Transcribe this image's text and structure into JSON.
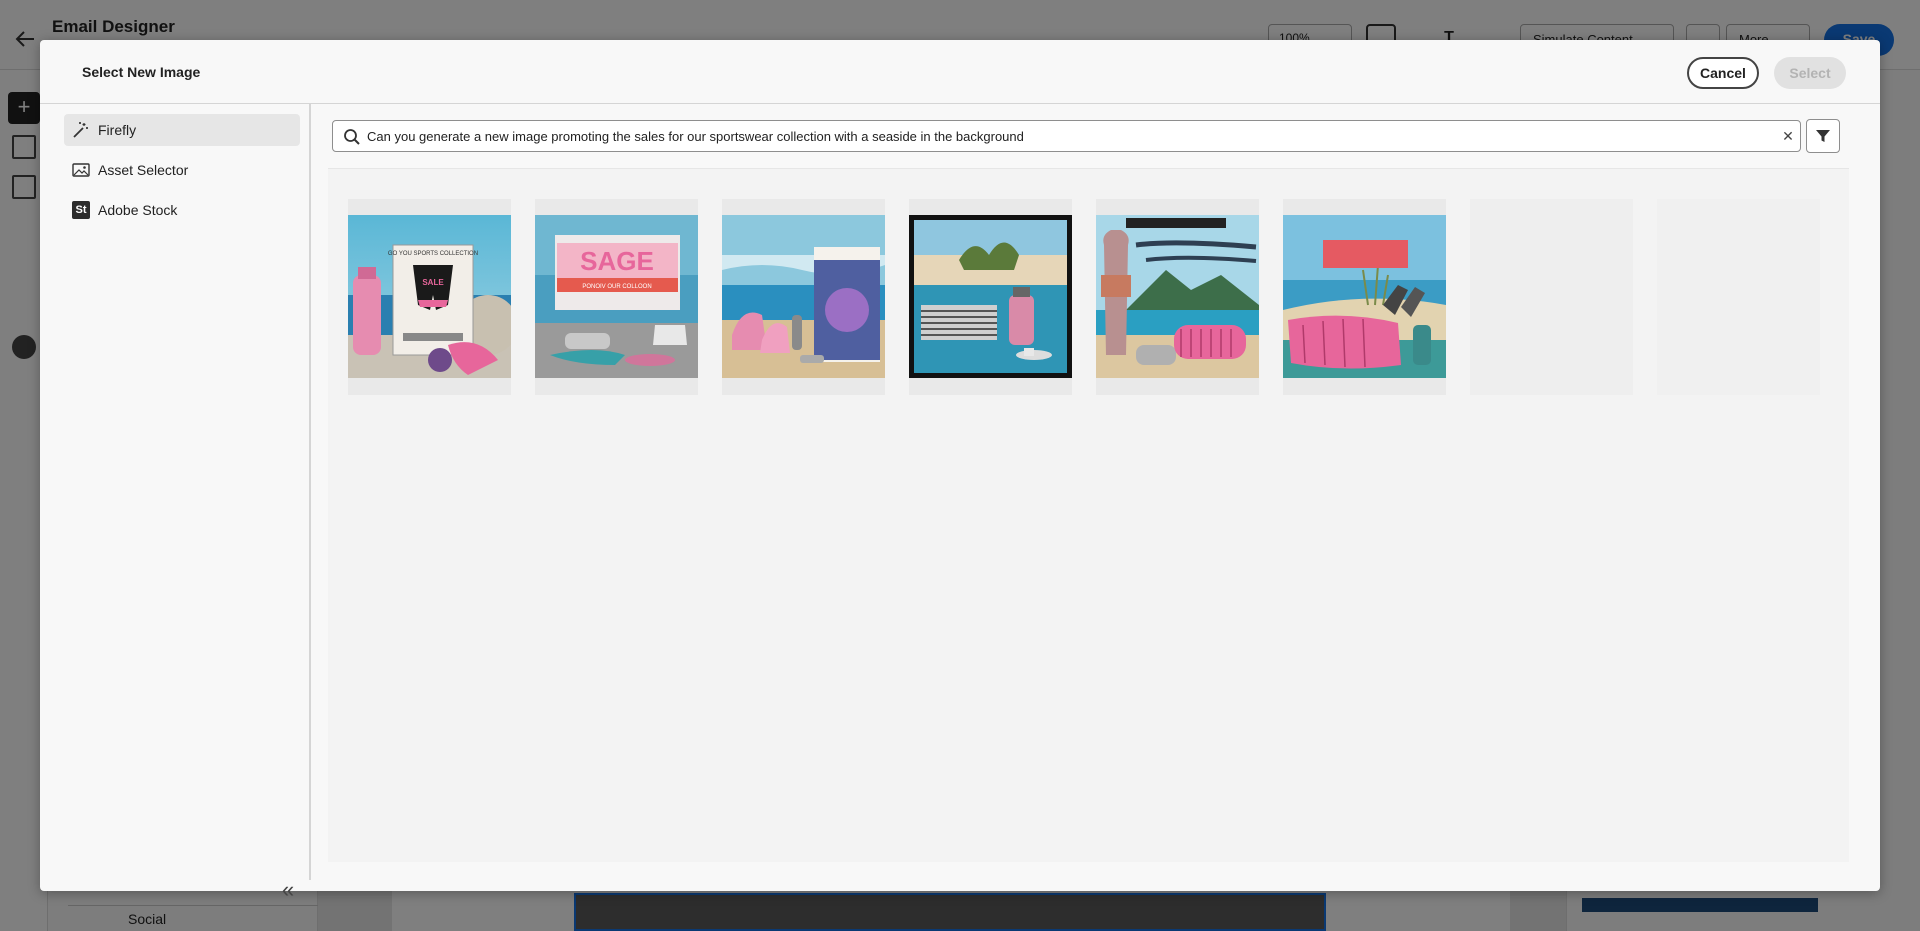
{
  "app": {
    "title": "Email Designer",
    "zoom": "100%",
    "simulate_label": "Simulate Content",
    "more_label": "More",
    "save_label": "Save",
    "nav_social_label": "Social"
  },
  "modal": {
    "title": "Select New Image",
    "cancel_label": "Cancel",
    "select_label": "Select",
    "sources": [
      {
        "label": "Firefly",
        "icon": "magic-wand-icon",
        "active": true
      },
      {
        "label": "Asset Selector",
        "icon": "image-icon",
        "active": false
      },
      {
        "label": "Adobe Stock",
        "icon": "adobe-stock-icon",
        "active": false
      }
    ],
    "adobe_stock_logo_text": "St",
    "search": {
      "value": "Can you generate a new image promoting the sales for our sportswear collection with a seaside in the background"
    },
    "results": [
      {
        "name": "generated-image-1",
        "caption": "SALE",
        "headline": "GO YOU SPORTS COLLECTION"
      },
      {
        "name": "generated-image-2",
        "caption": "SAGE",
        "headline": "PONOIV OUR COLLOON"
      },
      {
        "name": "generated-image-3",
        "caption": "",
        "headline": ""
      },
      {
        "name": "generated-image-4",
        "caption": "",
        "headline": ""
      },
      {
        "name": "generated-image-5",
        "caption": "",
        "headline": ""
      },
      {
        "name": "generated-image-6",
        "caption": "",
        "headline": ""
      },
      {
        "name": "loading-placeholder-1"
      },
      {
        "name": "loading-placeholder-2"
      }
    ]
  },
  "colors": {
    "brand_blue": "#1473e6",
    "overlay": "rgba(0,0,0,0.5)",
    "modal_bg": "#f8f8f8",
    "accent_pink": "#e7669b",
    "sea_blue": "#2a7fb0"
  }
}
